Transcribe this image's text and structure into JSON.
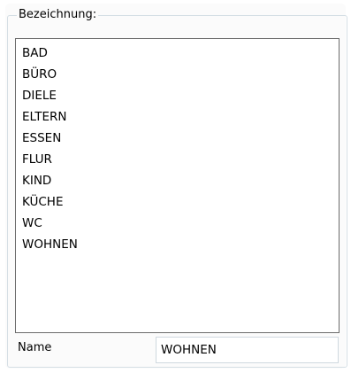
{
  "group": {
    "legend": "Bezeichnung:"
  },
  "list": {
    "items": [
      "BAD",
      "BÜRO",
      "DIELE",
      "ELTERN",
      "ESSEN",
      "FLUR",
      "KIND",
      "KÜCHE",
      "WC",
      "WOHNEN"
    ]
  },
  "name_field": {
    "label": "Name",
    "value": "WOHNEN"
  },
  "colors": {
    "panel_bg": "#fbfbfb",
    "group_border": "#d5dfe5",
    "list_border": "#6b6b6b"
  }
}
